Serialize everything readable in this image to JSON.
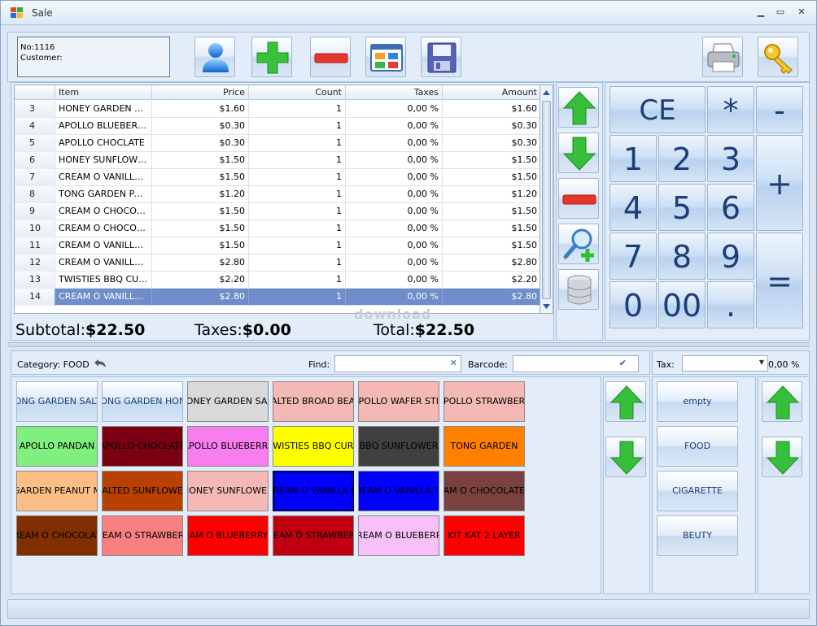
{
  "window": {
    "title": "Sale"
  },
  "order": {
    "no_line": "No:1116",
    "customer_line": "Customer:"
  },
  "grid": {
    "columns": [
      "Item",
      "Price",
      "Count",
      "Taxes",
      "Amount"
    ],
    "rows": [
      {
        "n": "3",
        "item": "HONEY GARDEN SAL…",
        "price": "$1.60",
        "count": "1",
        "taxes": "0,00 %",
        "amount": "$1.60"
      },
      {
        "n": "4",
        "item": "APOLLO BLUEBERRY",
        "price": "$0.30",
        "count": "1",
        "taxes": "0,00 %",
        "amount": "$0.30"
      },
      {
        "n": "5",
        "item": "APOLLO CHOCLATE",
        "price": "$0.30",
        "count": "1",
        "taxes": "0,00 %",
        "amount": "$0.30"
      },
      {
        "n": "6",
        "item": "HONEY SUNFLOWER 2",
        "price": "$1.50",
        "count": "1",
        "taxes": "0,00 %",
        "amount": "$1.50"
      },
      {
        "n": "7",
        "item": "CREAM O VANILLA S…",
        "price": "$1.50",
        "count": "1",
        "taxes": "0,00 %",
        "amount": "$1.50"
      },
      {
        "n": "8",
        "item": "TONG GARDEN PAPR…",
        "price": "$1.20",
        "count": "1",
        "taxes": "0,00 %",
        "amount": "$1.20"
      },
      {
        "n": "9",
        "item": "CREAM O CHOCOLA…",
        "price": "$1.50",
        "count": "1",
        "taxes": "0,00 %",
        "amount": "$1.50"
      },
      {
        "n": "10",
        "item": "CREAM O CHOCOLA…",
        "price": "$1.50",
        "count": "1",
        "taxes": "0,00 %",
        "amount": "$1.50"
      },
      {
        "n": "11",
        "item": "CREAM O VANILLA S…",
        "price": "$1.50",
        "count": "1",
        "taxes": "0,00 %",
        "amount": "$1.50"
      },
      {
        "n": "12",
        "item": "CREAM O VANILLA BIG",
        "price": "$2.80",
        "count": "1",
        "taxes": "0,00 %",
        "amount": "$2.80"
      },
      {
        "n": "13",
        "item": "TWISTIES BBQ CURRY",
        "price": "$2.20",
        "count": "1",
        "taxes": "0,00 %",
        "amount": "$2.20"
      },
      {
        "n": "14",
        "item": "CREAM O VANILLA BIG",
        "price": "$2.80",
        "count": "1",
        "taxes": "0,00 %",
        "amount": "$2.80",
        "selected": true
      }
    ]
  },
  "totals": {
    "subtotal_label": "Subtotal:",
    "subtotal_value": "$22.50",
    "taxes_label": "Taxes:",
    "taxes_value": "$0.00",
    "total_label": "Total:",
    "total_value": "$22.50"
  },
  "keypad": {
    "ce": "CE",
    "multiply": "*",
    "minus": "-",
    "plus": "+",
    "equals": "=",
    "k1": "1",
    "k2": "2",
    "k3": "3",
    "k4": "4",
    "k5": "5",
    "k6": "6",
    "k7": "7",
    "k8": "8",
    "k9": "9",
    "k0": "0",
    "k00": "00",
    "dot": "."
  },
  "browser": {
    "category_label": "Category: FOOD",
    "find_label": "Find:",
    "barcode_label": "Barcode:",
    "tax_label": "Tax:",
    "tax_value": "0,00 %"
  },
  "products": [
    {
      "label": "HONG GARDEN SALTE",
      "bg": "#c7dcf3",
      "fg": "#1b3d78"
    },
    {
      "label": "HONG GARDEN HONE",
      "bg": "#c7dcf3",
      "fg": "#1b3d78"
    },
    {
      "label": "HONEY GARDEN SALT",
      "bg": "#d9d9d9",
      "fg": "#000000"
    },
    {
      "label": "SALTED BROAD BEAN",
      "bg": "#f4b9b4",
      "fg": "#000000"
    },
    {
      "label": "APOLLO WAFER STIC",
      "bg": "#f4b9b4",
      "fg": "#000000"
    },
    {
      "label": "APOLLO STRAWBERR",
      "bg": "#f4b9b4",
      "fg": "#000000"
    },
    {
      "label": "APOLLO PANDAN",
      "bg": "#7fef7f",
      "fg": "#000000"
    },
    {
      "label": "APOLLO CHOCLATE",
      "bg": "#7a0012",
      "fg": "#000000"
    },
    {
      "label": "APOLLO BLUEBERRY",
      "bg": "#f87ef0",
      "fg": "#000000"
    },
    {
      "label": "TWISTIES BBQ CURR",
      "bg": "#ffff00",
      "fg": "#000000"
    },
    {
      "label": "BBQ SUNFLOWER",
      "bg": "#404040",
      "fg": "#000000"
    },
    {
      "label": "TONG GARDEN",
      "bg": "#ff8000",
      "fg": "#000000"
    },
    {
      "label": "GARDEN PEANUT M",
      "bg": "#fbbf86",
      "fg": "#000000"
    },
    {
      "label": "SALTED SUNFLOWER",
      "bg": "#b84000",
      "fg": "#000000"
    },
    {
      "label": "HONEY SUNFLOWER",
      "bg": "#f4b9b4",
      "fg": "#000000"
    },
    {
      "label": "CREAM O VANILLA BI",
      "bg": "#0000ff",
      "fg": "#000000",
      "selected": true
    },
    {
      "label": "CREAM O VANILLA SM",
      "bg": "#0000ff",
      "fg": "#000000"
    },
    {
      "label": "CREAM O CHOCOLATE BIG",
      "bg": "#7b4040",
      "fg": "#000000"
    },
    {
      "label": "CREAM O CHOCOLATE",
      "bg": "#803000",
      "fg": "#000000"
    },
    {
      "label": "CREAM O STRAWBERRY",
      "bg": "#f88080",
      "fg": "#000000"
    },
    {
      "label": "CREAM O BLUEBERRY SM",
      "bg": "#ff0000",
      "fg": "#000000"
    },
    {
      "label": "CREAM O STRAWBERRY",
      "bg": "#c00010",
      "fg": "#000000"
    },
    {
      "label": "CREAM O BLUEBERRY",
      "bg": "#f8c0f8",
      "fg": "#000000"
    },
    {
      "label": "KIT KAT 2 LAYER",
      "bg": "#ff0000",
      "fg": "#000000"
    }
  ],
  "categories": [
    {
      "label": "empty"
    },
    {
      "label": "FOOD"
    },
    {
      "label": "CIGARETTE"
    },
    {
      "label": "BEUTY"
    }
  ],
  "icons": [
    "user-icon",
    "add-icon",
    "remove-icon",
    "apps-icon",
    "save-icon",
    "printer-icon",
    "key-icon",
    "arrow-up-icon",
    "arrow-down-icon",
    "minus-icon",
    "search-add-icon",
    "database-icon",
    "back-arrow-icon",
    "clear-icon",
    "check-icon"
  ]
}
